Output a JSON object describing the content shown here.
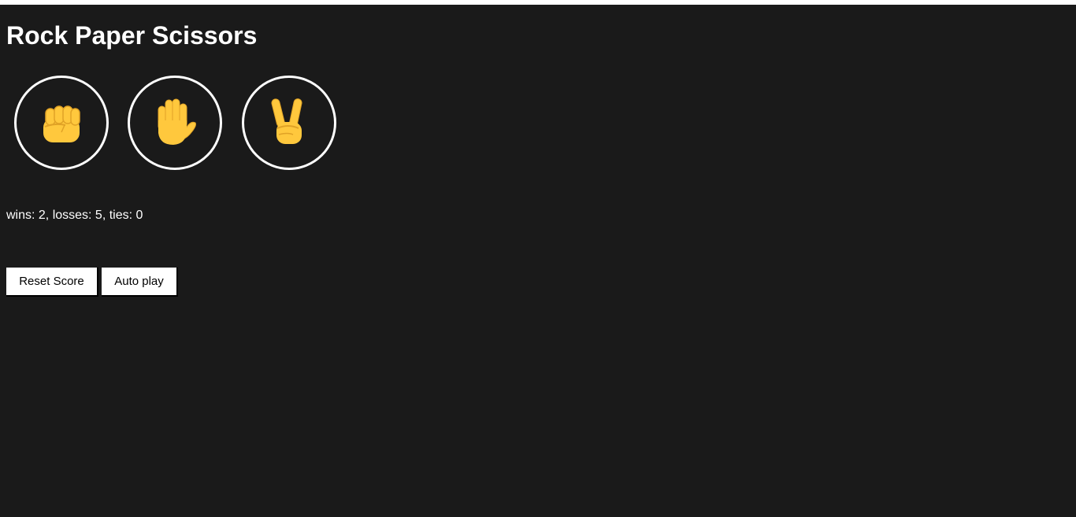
{
  "title": "Rock Paper Scissors",
  "moves": [
    {
      "name": "rock",
      "icon": "raised-fist-icon"
    },
    {
      "name": "paper",
      "icon": "raised-hand-icon"
    },
    {
      "name": "scissors",
      "icon": "victory-hand-icon"
    }
  ],
  "score": {
    "text": "wins: 2, losses: 5, ties: 0",
    "wins": 2,
    "losses": 5,
    "ties": 0
  },
  "buttons": {
    "reset_label": "Reset Score",
    "auto_label": "Auto play"
  },
  "colors": {
    "background": "#1a1a1a",
    "text": "#ffffff",
    "hand": "#ffc83d",
    "hand_shade": "#e0a226"
  }
}
